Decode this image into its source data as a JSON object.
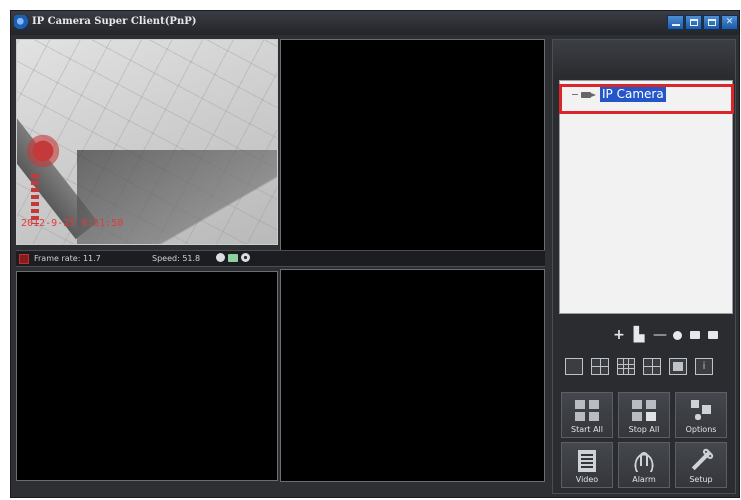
{
  "window": {
    "title": "IP Camera Super Client(PnP)",
    "controls": [
      "minimize-icon",
      "restore-icon",
      "maximize-icon",
      "close-icon"
    ]
  },
  "video": {
    "timestamp": "2012-9-25 9:51:58",
    "status": {
      "frame_rate": "Frame rate: 11.7",
      "speed": "Speed: 51.8"
    }
  },
  "device_tree": {
    "nodes": [
      {
        "label": "IP Camera",
        "selected": true,
        "icon": "camera-icon"
      }
    ],
    "tools": [
      "add-icon",
      "edit-device-icon",
      "remove-icon",
      "settings-icon",
      "box-icon",
      "square-icon"
    ]
  },
  "layouts": [
    "layout-1-icon",
    "layout-4-icon",
    "layout-9-icon",
    "layout-6-icon",
    "fullscreen-icon",
    "info-icon"
  ],
  "actions": [
    {
      "label": "Start All",
      "icon": "start-all-icon"
    },
    {
      "label": "Stop All",
      "icon": "stop-all-icon"
    },
    {
      "label": "Options",
      "icon": "options-icon"
    },
    {
      "label": "Video",
      "icon": "video-icon"
    },
    {
      "label": "Alarm",
      "icon": "alarm-icon"
    },
    {
      "label": "Setup",
      "icon": "setup-icon"
    }
  ],
  "colors": {
    "selection": "#2456c9",
    "highlight_box": "#d9262b",
    "timestamp": "#e23b3b"
  }
}
